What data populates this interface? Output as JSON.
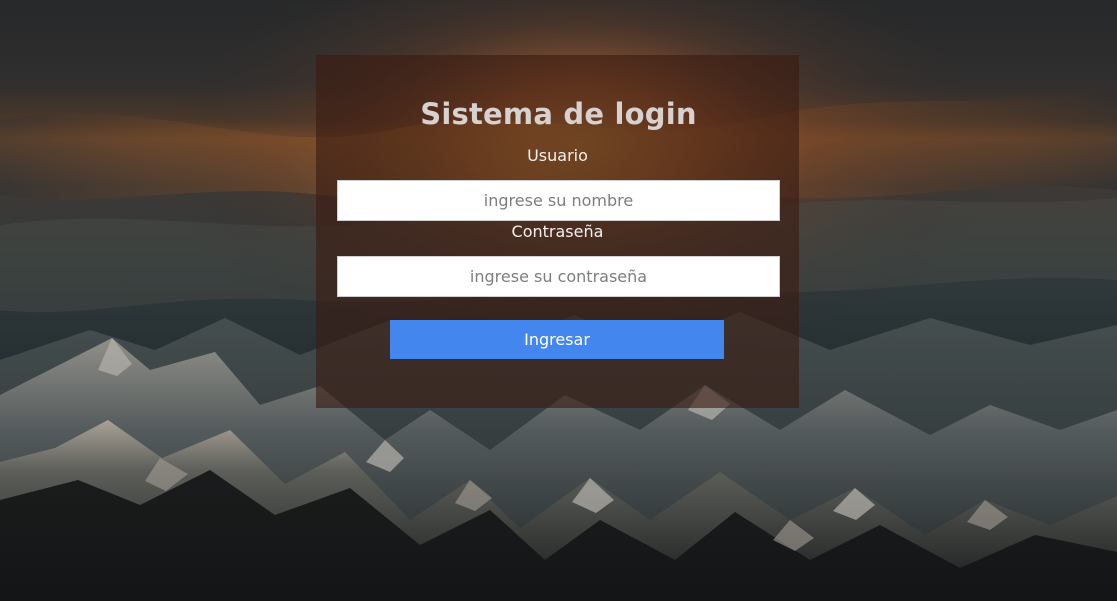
{
  "login": {
    "title": "Sistema de login",
    "username_label": "Usuario",
    "username_placeholder": "ingrese su nombre",
    "password_label": "Contraseña",
    "password_placeholder": "ingrese su contraseña",
    "submit_label": "Ingresar"
  },
  "colors": {
    "button": "#4286ee",
    "panel": "#3a1c12",
    "title": "#d7d2cf"
  }
}
